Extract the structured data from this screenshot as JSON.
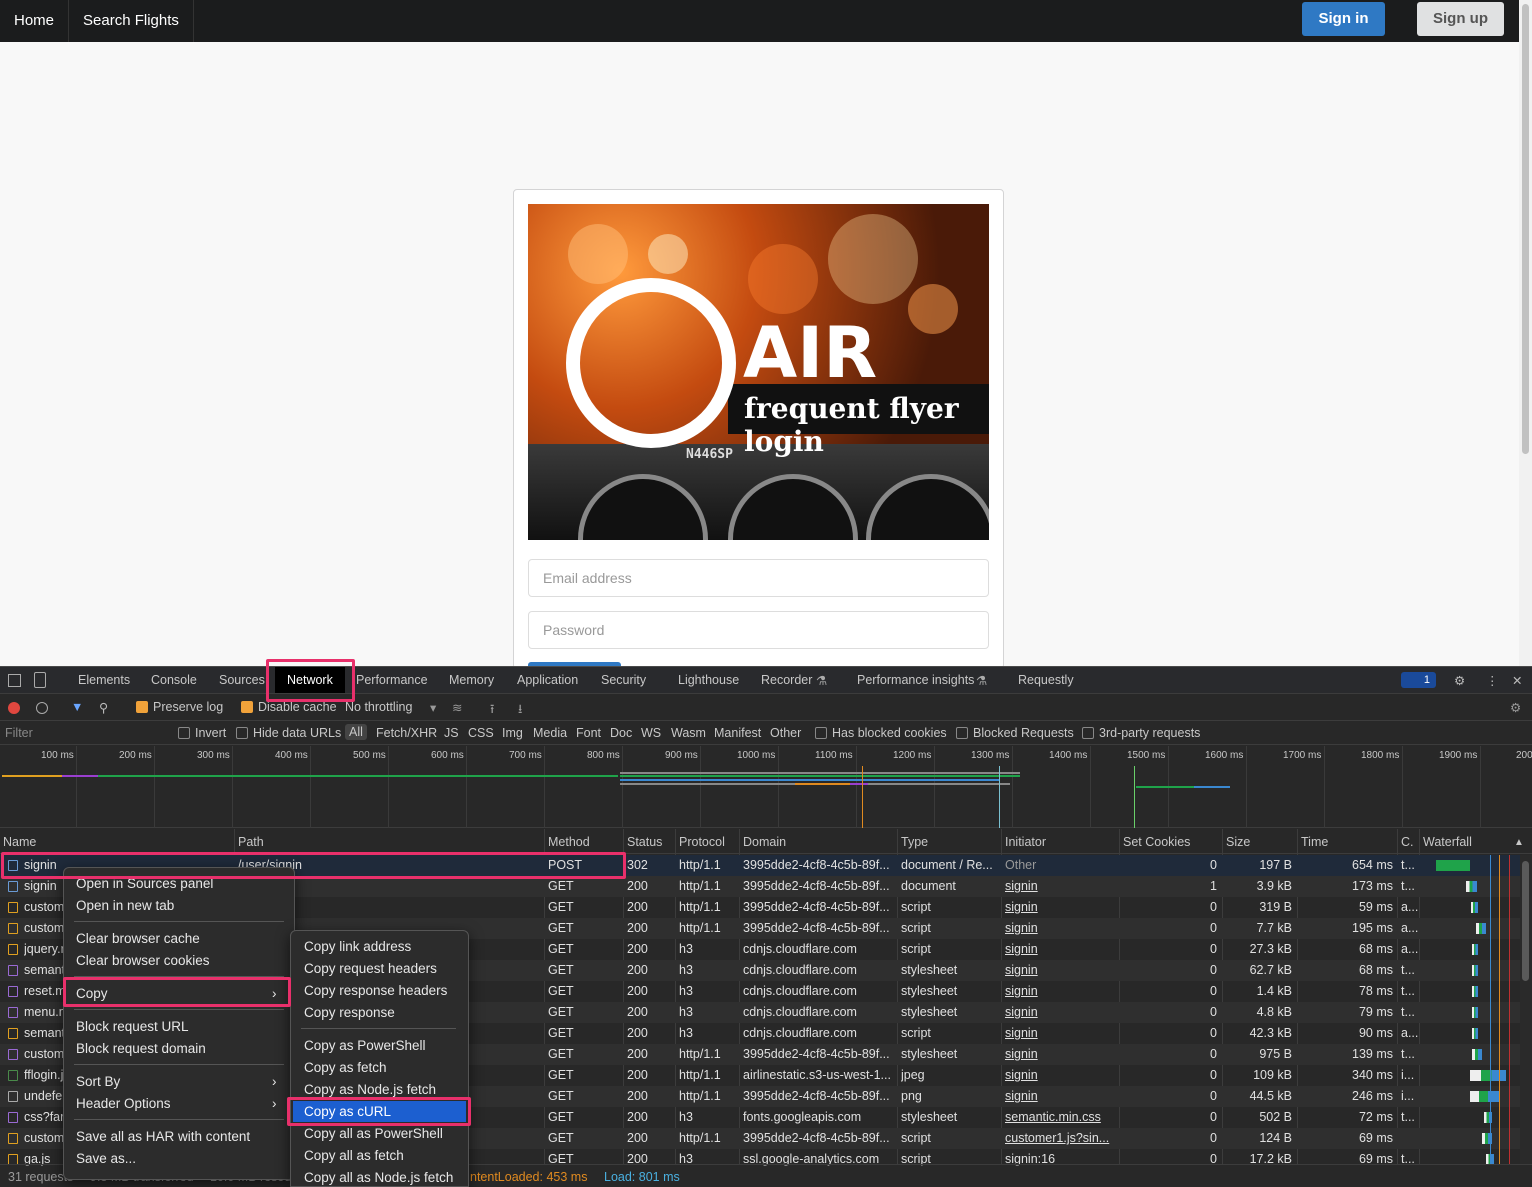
{
  "nav": {
    "home": "Home",
    "search_flights": "Search Flights",
    "sign_in": "Sign in",
    "sign_up": "Sign up"
  },
  "login": {
    "logo_air": "AIR",
    "logo_sub": "frequent flyer login",
    "tail_number": "N446SP",
    "email_placeholder": "Email address",
    "password_placeholder": "Password"
  },
  "devtools": {
    "tabs": [
      "Elements",
      "Console",
      "Sources",
      "Network",
      "Performance",
      "Memory",
      "Application",
      "Security",
      "Lighthouse",
      "Recorder",
      "Performance insights",
      "Requestly"
    ],
    "issues_count": "1",
    "toolbar": {
      "preserve_log": "Preserve log",
      "disable_cache": "Disable cache",
      "throttling": "No throttling"
    },
    "filter": {
      "placeholder": "Filter",
      "invert": "Invert",
      "hide_data_urls": "Hide data URLs",
      "types": [
        "All",
        "Fetch/XHR",
        "JS",
        "CSS",
        "Img",
        "Media",
        "Font",
        "Doc",
        "WS",
        "Wasm",
        "Manifest",
        "Other"
      ],
      "has_blocked_cookies": "Has blocked cookies",
      "blocked_requests": "Blocked Requests",
      "third_party": "3rd-party requests"
    },
    "ticks": [
      "100 ms",
      "200 ms",
      "300 ms",
      "400 ms",
      "500 ms",
      "600 ms",
      "700 ms",
      "800 ms",
      "900 ms",
      "1000 ms",
      "1100 ms",
      "1200 ms",
      "1300 ms",
      "1400 ms",
      "1500 ms",
      "1600 ms",
      "1700 ms",
      "1800 ms",
      "1900 ms",
      "200"
    ],
    "columns": [
      "Name",
      "Path",
      "Method",
      "Status",
      "Protocol",
      "Domain",
      "Type",
      "Initiator",
      "Set Cookies",
      "Size",
      "Time",
      "C.",
      "Waterfall"
    ],
    "rows": [
      {
        "name": "signin",
        "path": "/user/signin",
        "method": "POST",
        "status": "302",
        "protocol": "http/1.1",
        "domain": "3995dde2-4cf8-4c5b-89f...",
        "type": "document / Re...",
        "initiator": "Other",
        "cookies": "0",
        "size": "197 B",
        "time": "654 ms",
        "c": "t..."
      },
      {
        "name": "signin",
        "path": "n",
        "method": "GET",
        "status": "200",
        "protocol": "http/1.1",
        "domain": "3995dde2-4cf8-4c5b-89f...",
        "type": "document",
        "initiator": "signin",
        "cookies": "1",
        "size": "3.9 kB",
        "time": "173 ms",
        "c": "t..."
      },
      {
        "name": "custom",
        "path": "l.js",
        "method": "GET",
        "status": "200",
        "protocol": "http/1.1",
        "domain": "3995dde2-4cf8-4c5b-89f...",
        "type": "script",
        "initiator": "signin",
        "cookies": "0",
        "size": "319 B",
        "time": "59 ms",
        "c": "a..."
      },
      {
        "name": "custom",
        "path": "l.js",
        "method": "GET",
        "status": "200",
        "protocol": "http/1.1",
        "domain": "3995dde2-4cf8-4c5b-89f...",
        "type": "script",
        "initiator": "signin",
        "cookies": "0",
        "size": "7.7 kB",
        "time": "195 ms",
        "c": "a..."
      },
      {
        "name": "jquery.r",
        "path": "",
        "method": "GET",
        "status": "200",
        "protocol": "h3",
        "domain": "cdnjs.cloudflare.com",
        "type": "script",
        "initiator": "signin",
        "cookies": "0",
        "size": "27.3 kB",
        "time": "68 ms",
        "c": "a..."
      },
      {
        "name": "semant",
        "path": "css",
        "method": "GET",
        "status": "200",
        "protocol": "h3",
        "domain": "cdnjs.cloudflare.com",
        "type": "stylesheet",
        "initiator": "signin",
        "cookies": "0",
        "size": "62.7 kB",
        "time": "68 ms",
        "c": "t..."
      },
      {
        "name": "reset.m",
        "path": "set.min.css",
        "method": "GET",
        "status": "200",
        "protocol": "h3",
        "domain": "cdnjs.cloudflare.com",
        "type": "stylesheet",
        "initiator": "signin",
        "cookies": "0",
        "size": "1.4 kB",
        "time": "78 ms",
        "c": "t..."
      },
      {
        "name": "menu.m",
        "path": "enu.min.css",
        "method": "GET",
        "status": "200",
        "protocol": "h3",
        "domain": "cdnjs.cloudflare.com",
        "type": "stylesheet",
        "initiator": "signin",
        "cookies": "0",
        "size": "4.8 kB",
        "time": "79 ms",
        "c": "t..."
      },
      {
        "name": "semant",
        "path": "js",
        "method": "GET",
        "status": "200",
        "protocol": "h3",
        "domain": "cdnjs.cloudflare.com",
        "type": "script",
        "initiator": "signin",
        "cookies": "0",
        "size": "42.3 kB",
        "time": "90 ms",
        "c": "a..."
      },
      {
        "name": "custom",
        "path": "",
        "method": "GET",
        "status": "200",
        "protocol": "http/1.1",
        "domain": "3995dde2-4cf8-4c5b-89f...",
        "type": "stylesheet",
        "initiator": "signin",
        "cookies": "0",
        "size": "975 B",
        "time": "139 ms",
        "c": "t..."
      },
      {
        "name": "fflogin.j",
        "path": "",
        "method": "GET",
        "status": "200",
        "protocol": "http/1.1",
        "domain": "airlinestatic.s3-us-west-1...",
        "type": "jpeg",
        "initiator": "signin",
        "cookies": "0",
        "size": "109 kB",
        "time": "340 ms",
        "c": "i..."
      },
      {
        "name": "undefe",
        "path": "",
        "method": "GET",
        "status": "200",
        "protocol": "http/1.1",
        "domain": "3995dde2-4cf8-4c5b-89f...",
        "type": "png",
        "initiator": "signin",
        "cookies": "0",
        "size": "44.5 kB",
        "time": "246 ms",
        "c": "i..."
      },
      {
        "name": "css?far",
        "path": "",
        "method": "GET",
        "status": "200",
        "protocol": "h3",
        "domain": "fonts.googleapis.com",
        "type": "stylesheet",
        "initiator": "semantic.min.css",
        "cookies": "0",
        "size": "502 B",
        "time": "72 ms",
        "c": "t..."
      },
      {
        "name": "custom",
        "path": "",
        "method": "GET",
        "status": "200",
        "protocol": "http/1.1",
        "domain": "3995dde2-4cf8-4c5b-89f...",
        "type": "script",
        "initiator": "customer1.js?sin...",
        "cookies": "0",
        "size": "124 B",
        "time": "69 ms",
        "c": ""
      },
      {
        "name": "ga.js",
        "path": "",
        "method": "GET",
        "status": "200",
        "protocol": "h3",
        "domain": "ssl.google-analytics.com",
        "type": "script",
        "initiator": "signin:16",
        "cookies": "0",
        "size": "17.2 kB",
        "time": "69 ms",
        "c": "t..."
      }
    ],
    "status_bar": {
      "requests": "31 requests",
      "transferred": "9.3 MB transferred",
      "resources": "10.0 MB resou",
      "dcl": "ntentLoaded: 453 ms",
      "load": "Load: 801 ms"
    },
    "context_menu": [
      "Open in Sources panel",
      "Open in new tab",
      "Clear browser cache",
      "Clear browser cookies",
      "Copy",
      "Block request URL",
      "Block request domain",
      "Sort By",
      "Header Options",
      "Save all as HAR with content",
      "Save as..."
    ],
    "copy_submenu": [
      "Copy link address",
      "Copy request headers",
      "Copy response headers",
      "Copy response",
      "Copy as PowerShell",
      "Copy as fetch",
      "Copy as Node.js fetch",
      "Copy as cURL",
      "Copy all as PowerShell",
      "Copy all as fetch",
      "Copy all as Node.js fetch"
    ]
  }
}
